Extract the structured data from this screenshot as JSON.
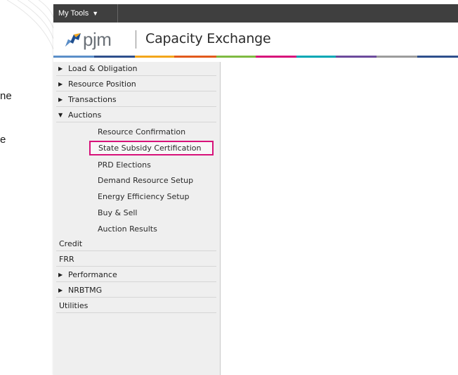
{
  "background_fragments": [
    "ne",
    "e"
  ],
  "toolbar": {
    "my_tools_label": "My Tools",
    "my_tools_caret": "▼"
  },
  "header": {
    "logo_text": "pjm",
    "app_title": "Capacity Exchange"
  },
  "brand_colors": [
    "#5b8fc9",
    "#2e4f8c",
    "#f3a61b",
    "#e25a1c",
    "#7fba42",
    "#d7127a",
    "#00a7b5",
    "#6c4b9c",
    "#9c9c9c",
    "#2e4f8c"
  ],
  "sidebar": {
    "items": [
      {
        "label": "Load & Obligation",
        "expandable": true,
        "expanded": false
      },
      {
        "label": "Resource Position",
        "expandable": true,
        "expanded": false
      },
      {
        "label": "Transactions",
        "expandable": true,
        "expanded": false
      },
      {
        "label": "Auctions",
        "expandable": true,
        "expanded": true
      }
    ],
    "auction_subitems": [
      {
        "label": "Resource Confirmation",
        "selected": false
      },
      {
        "label": "State Subsidy Certification",
        "selected": true
      },
      {
        "label": "PRD Elections",
        "selected": false
      },
      {
        "label": "Demand Resource Setup",
        "selected": false
      },
      {
        "label": "Energy Efficiency Setup",
        "selected": false
      },
      {
        "label": "Buy & Sell",
        "selected": false
      },
      {
        "label": "Auction Results",
        "selected": false
      }
    ],
    "items_after": [
      {
        "label": "Credit",
        "expandable": false
      },
      {
        "label": "FRR",
        "expandable": false
      },
      {
        "label": "Performance",
        "expandable": true,
        "expanded": false
      },
      {
        "label": "NRBTMG",
        "expandable": true,
        "expanded": false
      },
      {
        "label": "Utilities",
        "expandable": false
      }
    ],
    "collapsed_arrow": "▶",
    "expanded_arrow": "▼",
    "highlight_color": "#d7127a"
  }
}
